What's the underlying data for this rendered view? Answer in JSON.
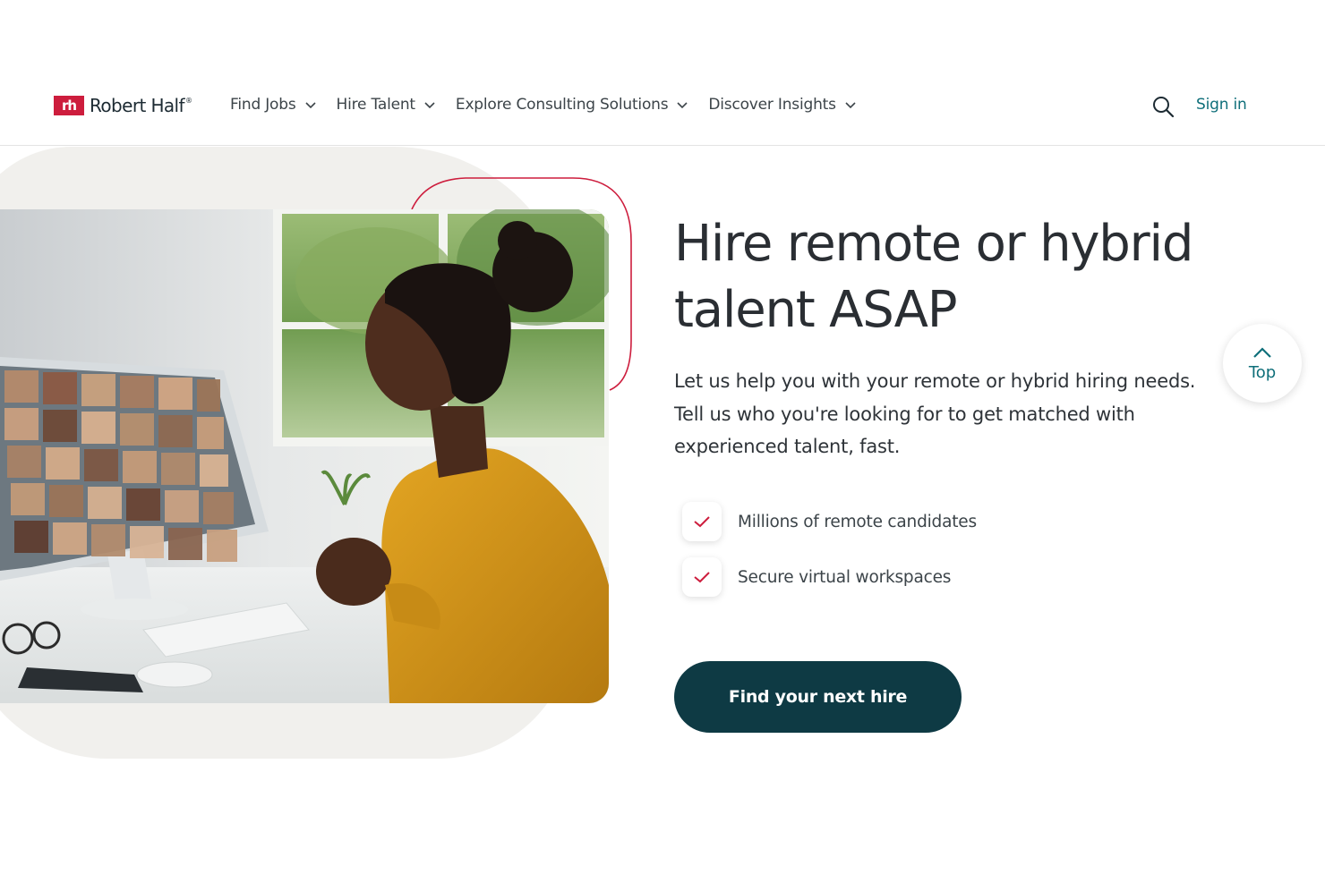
{
  "brand": {
    "name": "Robert Half",
    "mark": "rh",
    "reg": "®"
  },
  "nav": {
    "items": [
      {
        "label": "Find Jobs"
      },
      {
        "label": "Hire Talent"
      },
      {
        "label": "Explore Consulting Solutions"
      },
      {
        "label": "Discover Insights"
      }
    ],
    "search_icon": "search-icon",
    "signin_label": "Sign in"
  },
  "hero": {
    "title": "Hire remote or hybrid talent ASAP",
    "description": "Let us help you with your remote or hybrid hiring needs. Tell us who you're looking for to get matched with experienced talent, fast.",
    "features": [
      {
        "label": "Millions of remote candidates",
        "icon": "check-icon"
      },
      {
        "label": "Secure virtual workspaces",
        "icon": "check-icon"
      }
    ],
    "cta_label": "Find your next hire",
    "image_subject": "woman in video call with many participants"
  },
  "back_to_top": {
    "label": "Top",
    "icon": "chevron-up-icon"
  },
  "colors": {
    "brand_red": "#cd1d3d",
    "teal_link": "#0f6f7a",
    "cta_bg": "#0e3a44",
    "blob_bg": "#f1f0ed",
    "text": "#2a2e33"
  }
}
